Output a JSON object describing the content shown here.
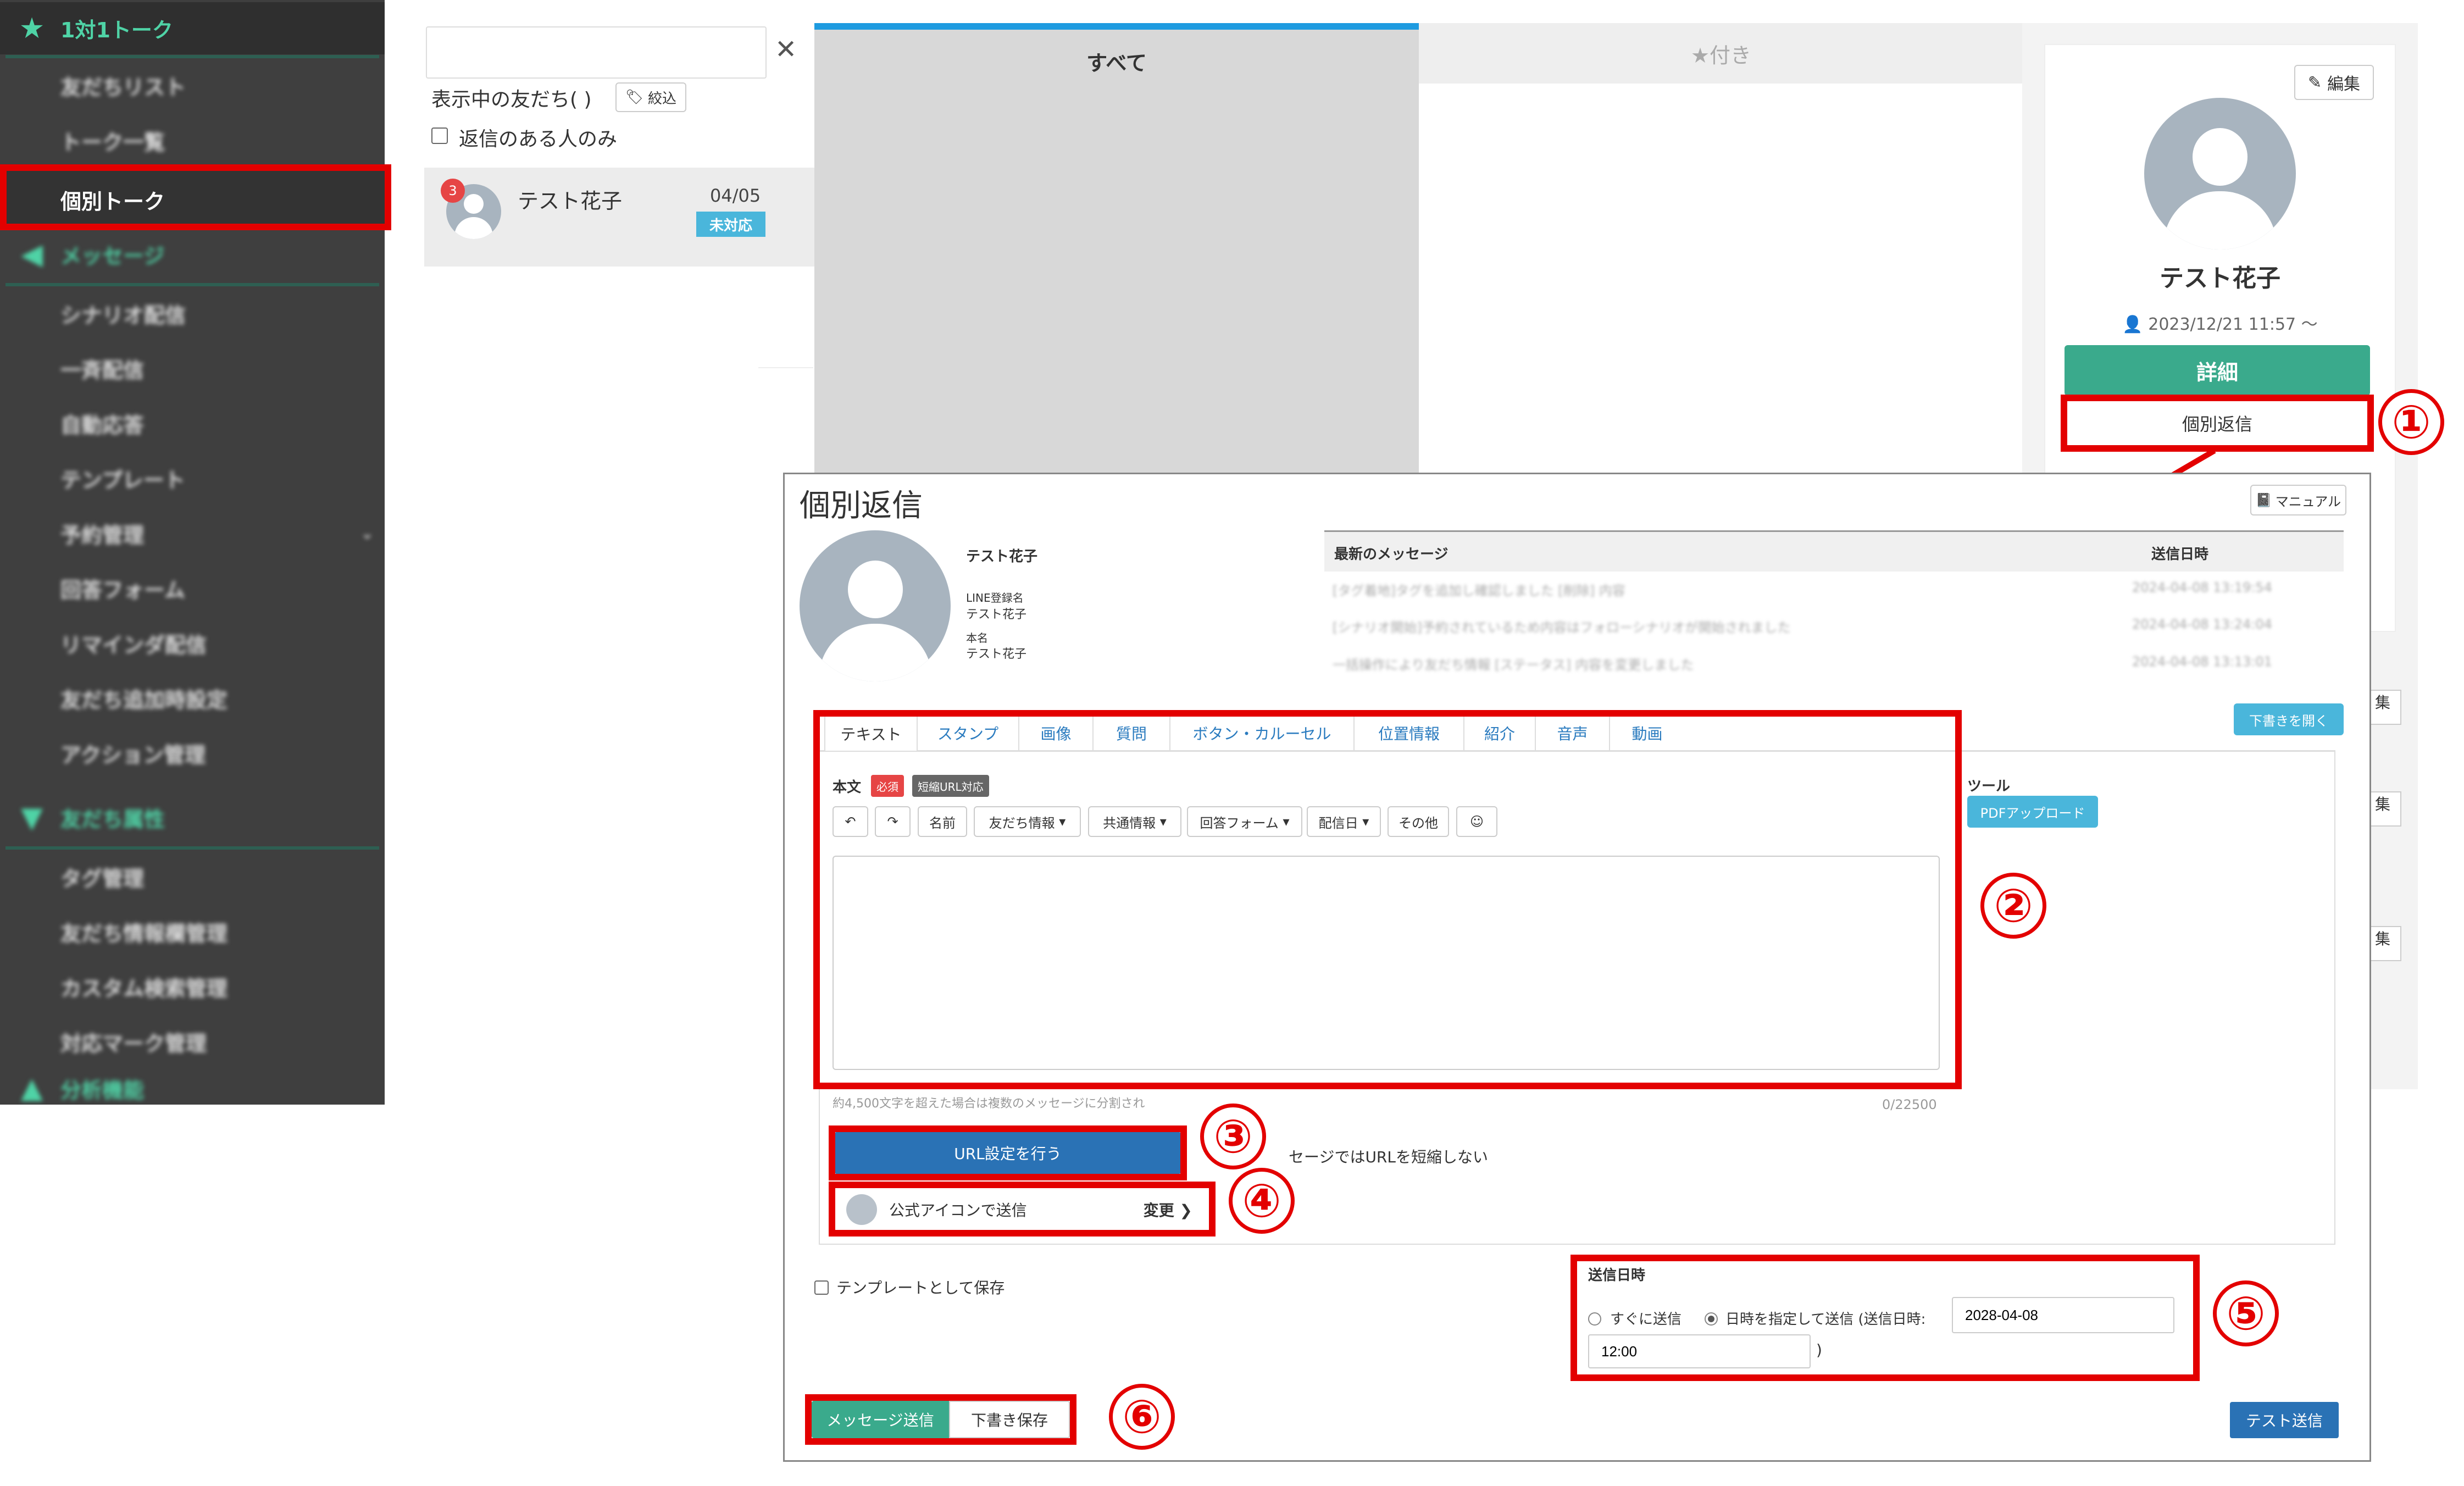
{
  "sidebar": {
    "talk_header": "1対1トーク",
    "talk_items": [
      "友だちリスト",
      "トーク一覧",
      "個別トーク"
    ],
    "message_header": "メッセージ",
    "message_items": [
      "シナリオ配信",
      "一斉配信",
      "自動応答",
      "テンプレート",
      "予約管理",
      "回答フォーム",
      "リマインダ配信",
      "友だち追加時設定",
      "アクション管理"
    ],
    "friend_header": "友だち属性",
    "friend_items": [
      "タグ管理",
      "友だち情報欄管理",
      "カスタム検索管理",
      "対応マーク管理"
    ],
    "analysis_header": "分析機能"
  },
  "friend_list": {
    "search_value": "",
    "showing_label": "表示中の友だち( )",
    "filter_label": "絞込",
    "reply_only_label": "返信のある人のみ",
    "item": {
      "badge": "3",
      "name": "テスト花子",
      "date": "04/05",
      "status": "未対応"
    }
  },
  "tabs": {
    "all": "すべて",
    "starred": "★付き"
  },
  "profile": {
    "edit_label": "編集",
    "name": "テスト花子",
    "since": "2023/12/21 11:57 〜",
    "detail_button": "詳細",
    "reply_button": "個別返信"
  },
  "modal": {
    "title": "個別返信",
    "manual_label": "マニュアル",
    "user": {
      "name": "テスト花子",
      "line_label": "LINE登録名",
      "line_name": "テスト花子",
      "real_label": "本名",
      "real_name": "テスト花子"
    },
    "messages_header": {
      "msg": "最新のメッセージ",
      "date": "送信日時"
    },
    "messages": [
      {
        "text": "[タグ着地]タグを追加し確認しました [削除] 内容",
        "date": "2024-04-08 13:19:54"
      },
      {
        "text": "[シナリオ開始]予約されているため内容はフォローシナリオが開始されました",
        "date": "2024-04-08 13:24:04"
      },
      {
        "text": "一括操作により友だち情報 [ステータス] 内容を変更しました",
        "date": "2024-04-08 13:13:01"
      }
    ],
    "open_draft": "下書きを開く",
    "tabs": [
      "テキスト",
      "スタンプ",
      "画像",
      "質問",
      "ボタン・カルーセル",
      "位置情報",
      "紹介",
      "音声",
      "動画"
    ],
    "body_label": "本文",
    "required_badge": "必須",
    "short_url_badge": "短縮URL対応",
    "toolbar": {
      "name": "名前",
      "friend_info": "友だち情報",
      "common_info": "共通情報",
      "answer_form": "回答フォーム",
      "delivery_date": "配信日",
      "other": "その他"
    },
    "tools_label": "ツール",
    "pdf_upload": "PDFアップロード",
    "split_note": "約4,500文字を超えた場合は複数のメッセージに分割され",
    "char_count": "0/22500",
    "url_button": "URL設定を行う",
    "url_note": "セージではURLを短縮しない",
    "icon_send": "公式アイコンで送信",
    "change_label": "変更",
    "save_template": "テンプレートとして保存",
    "send_time_label": "送信日時",
    "send_now": "すぐに送信",
    "send_scheduled": "日時を指定して送信 (送信日時:",
    "date_value": "2028-04-08",
    "time_value": "12:00",
    "paren_close": ")",
    "send_button": "メッセージ送信",
    "draft_button": "下書き保存",
    "test_send": "テスト送信"
  },
  "callouts": [
    "①",
    "②",
    "③",
    "④",
    "⑤",
    "⑥"
  ],
  "colors": {
    "green": "#3aaa8c",
    "blue": "#2a72b5",
    "light_blue": "#4ab6db",
    "red": "#e30000",
    "sidebar": "#3f3f3f",
    "tab_active": "#1e9be0"
  }
}
